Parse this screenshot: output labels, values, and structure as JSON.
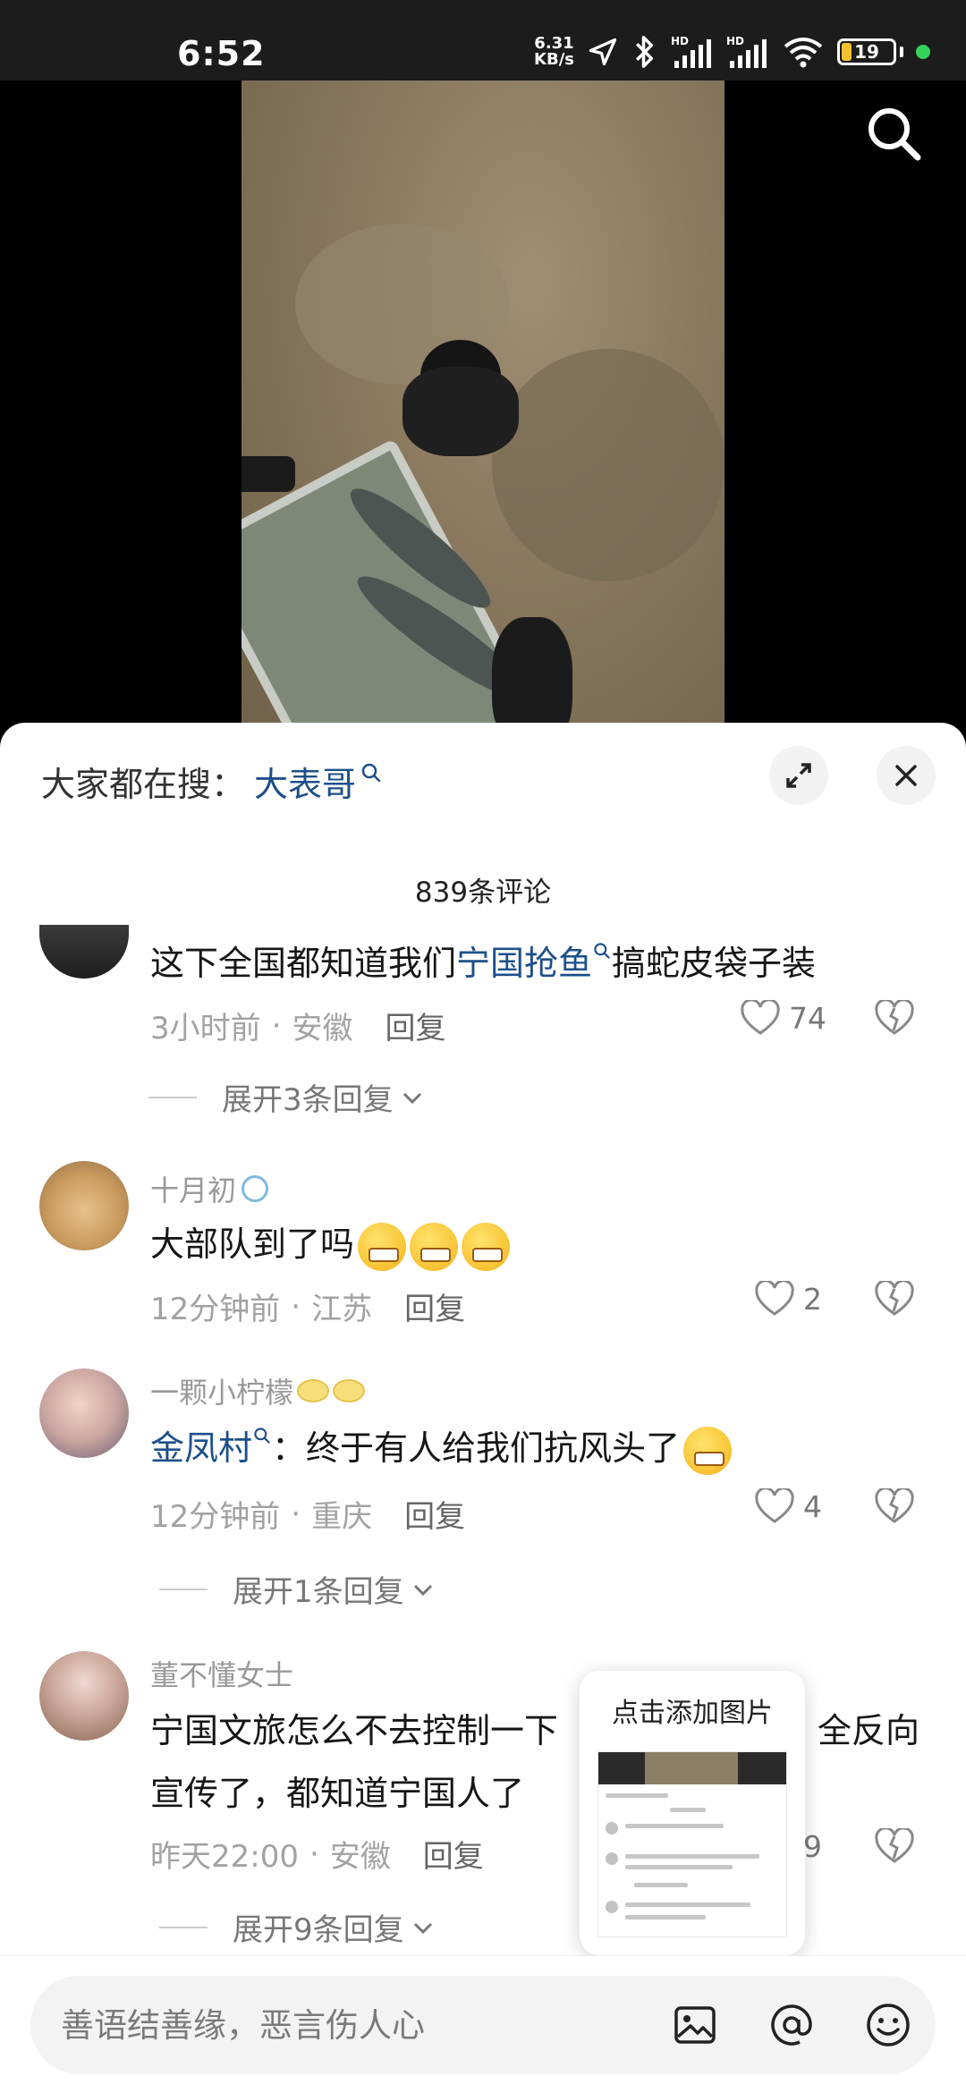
{
  "status_bar": {
    "time": "6:52",
    "net_speed_value": "6.31",
    "net_speed_unit": "KB/s",
    "battery_level": "19"
  },
  "hot_search": {
    "prefix": "大家都在搜：",
    "term": "大表哥"
  },
  "comments_header": {
    "count_label": "839条评论"
  },
  "comments": [
    {
      "name": "",
      "text_before": "这下全国都知道我们",
      "link": "宁国抢鱼",
      "text_after": "搞蛇皮袋子装",
      "time": "3小时前",
      "location": "安徽",
      "reply_label": "回复",
      "likes": "74",
      "expand_label": "展开3条回复"
    },
    {
      "name": "十月初",
      "text": "大部队到了吗",
      "time": "12分钟前",
      "location": "江苏",
      "reply_label": "回复",
      "likes": "2"
    },
    {
      "name": "一颗小柠檬",
      "link": "金凤村",
      "text_after": "：终于有人给我们抗风头了",
      "time": "12分钟前",
      "location": "重庆",
      "reply_label": "回复",
      "likes": "4",
      "expand_label": "展开1条回复"
    },
    {
      "name": "董不懂女士",
      "text_line1_a": "宁国文旅怎么不去控制一下",
      "text_line1_b": "全反向",
      "text_line2": "宣传了，都知道宁国人了",
      "time": "昨天22:00",
      "location": "安徽",
      "reply_label": "回复",
      "likes": "9",
      "expand_label": "展开9条回复"
    }
  ],
  "meta_separator": "·",
  "image_popup": {
    "title": "点击添加图片"
  },
  "input_bar": {
    "placeholder": "善语结善缘，恶言伤人心"
  },
  "colors": {
    "link": "#1d4f8a",
    "battery": "#f2c230",
    "online_dot": "#33d35a"
  }
}
